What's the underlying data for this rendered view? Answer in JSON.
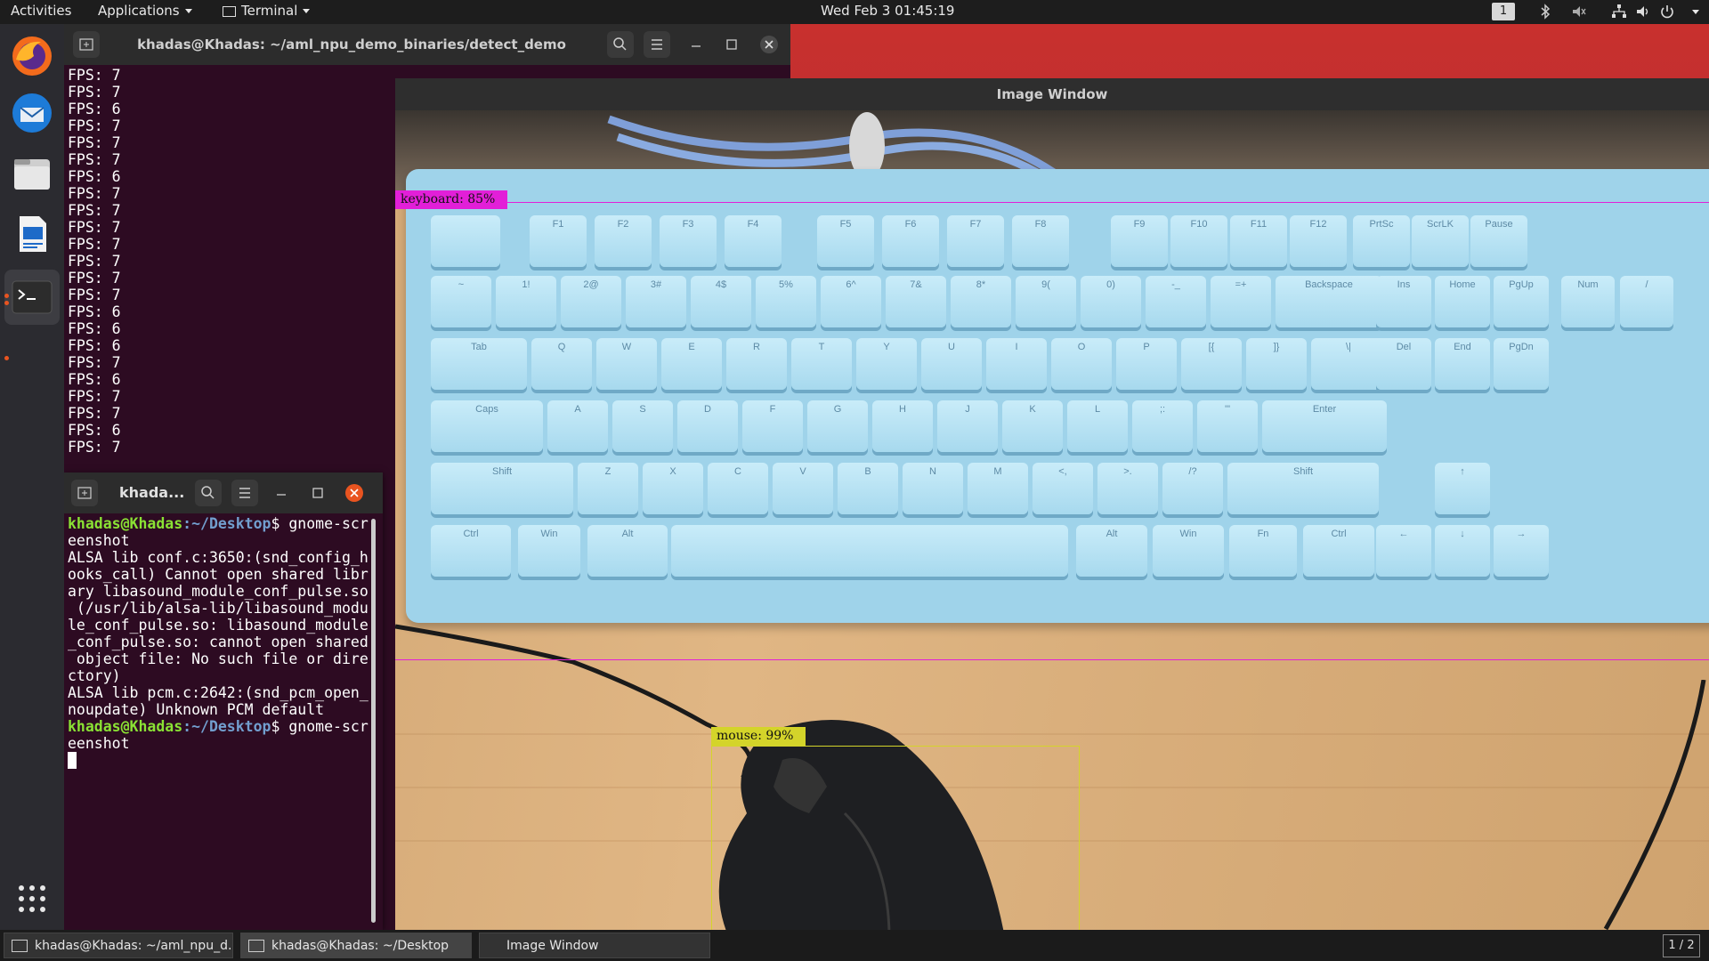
{
  "topbar": {
    "activities": "Activities",
    "applications": "Applications",
    "terminal_menu": "Terminal",
    "clock": "Wed Feb 3  01:45:19",
    "workspace": "1"
  },
  "dock": {
    "apps": [
      "firefox-icon",
      "thunderbird-icon",
      "files-icon",
      "writer-icon",
      "terminal-icon"
    ],
    "show_apps": "app-grid-icon"
  },
  "terminal1": {
    "title": "khadas@Khadas: ~/aml_npu_demo_binaries/detect_demo",
    "lines": [
      "FPS: 7",
      "FPS: 7",
      "FPS: 6",
      "FPS: 7",
      "FPS: 7",
      "FPS: 7",
      "FPS: 6",
      "FPS: 7",
      "FPS: 7",
      "FPS: 7",
      "FPS: 7",
      "FPS: 7",
      "FPS: 7",
      "FPS: 7",
      "FPS: 6",
      "FPS: 6",
      "FPS: 6",
      "FPS: 7",
      "FPS: 6",
      "FPS: 7",
      "FPS: 7",
      "FPS: 6",
      "FPS: 7"
    ]
  },
  "terminal2": {
    "title": "khada...",
    "prompt_user": "khadas@Khadas",
    "prompt_path": ":~/Desktop",
    "cmd1": "$ gnome-scr",
    "cmd1b": "eenshot",
    "out": [
      "ALSA lib conf.c:3650:(snd_config_h",
      "ooks_call) Cannot open shared libr",
      "ary libasound_module_conf_pulse.so",
      " (/usr/lib/alsa-lib/libasound_modu",
      "le_conf_pulse.so: libasound_module",
      "_conf_pulse.so: cannot open shared",
      " object file: No such file or dire",
      "ctory)",
      "ALSA lib pcm.c:2642:(snd_pcm_open_",
      "noupdate) Unknown PCM default"
    ],
    "cmd2": "$ gnome-scr",
    "cmd2b": "eenshot"
  },
  "image_window": {
    "title": "Image Window",
    "detections": [
      {
        "label": "keyboard: 85%",
        "color": "#e21fd8"
      },
      {
        "label": "mouse: 99%",
        "color": "#d4d42a"
      }
    ],
    "keys_fn": [
      "F1",
      "F2",
      "F3",
      "F4",
      "F5",
      "F6",
      "F7",
      "F8",
      "F9",
      "F10",
      "F11",
      "F12",
      "PrtSc",
      "ScrLK",
      "Pause"
    ],
    "keys_num": [
      "~",
      "1!",
      "2@",
      "3#",
      "4$",
      "5%",
      "6^",
      "7&",
      "8*",
      "9(",
      "0)",
      "-_",
      "=+",
      "Backspace"
    ],
    "keys_top": [
      "Tab",
      "Q",
      "W",
      "E",
      "R",
      "T",
      "Y",
      "U",
      "I",
      "O",
      "P",
      "[{",
      "]}",
      "\\|"
    ],
    "keys_home": [
      "Caps",
      "A",
      "S",
      "D",
      "F",
      "G",
      "H",
      "J",
      "K",
      "L",
      ";:",
      "'\"",
      "Enter"
    ],
    "keys_shift": [
      "Shift",
      "Z",
      "X",
      "C",
      "V",
      "B",
      "N",
      "M",
      "<,",
      ">.",
      "/?",
      "Shift"
    ],
    "keys_bottom": [
      "Ctrl",
      "Win",
      "Alt",
      "Alt",
      "Win",
      "Fn",
      "Ctrl"
    ],
    "keys_nav": [
      "Ins",
      "Home",
      "PgUp",
      "Del",
      "End",
      "PgDn"
    ],
    "keys_numpad_top": [
      "Num",
      "/"
    ]
  },
  "taskbar": {
    "tasks": [
      "khadas@Khadas: ~/aml_npu_d...",
      "khadas@Khadas: ~/Desktop",
      "Image Window"
    ],
    "pager": "1 / 2"
  },
  "colors": {
    "terminal_bg": "#2d0b22",
    "prompt_green": "#8ae234",
    "prompt_blue": "#729fcf",
    "close_red": "#e95420"
  }
}
